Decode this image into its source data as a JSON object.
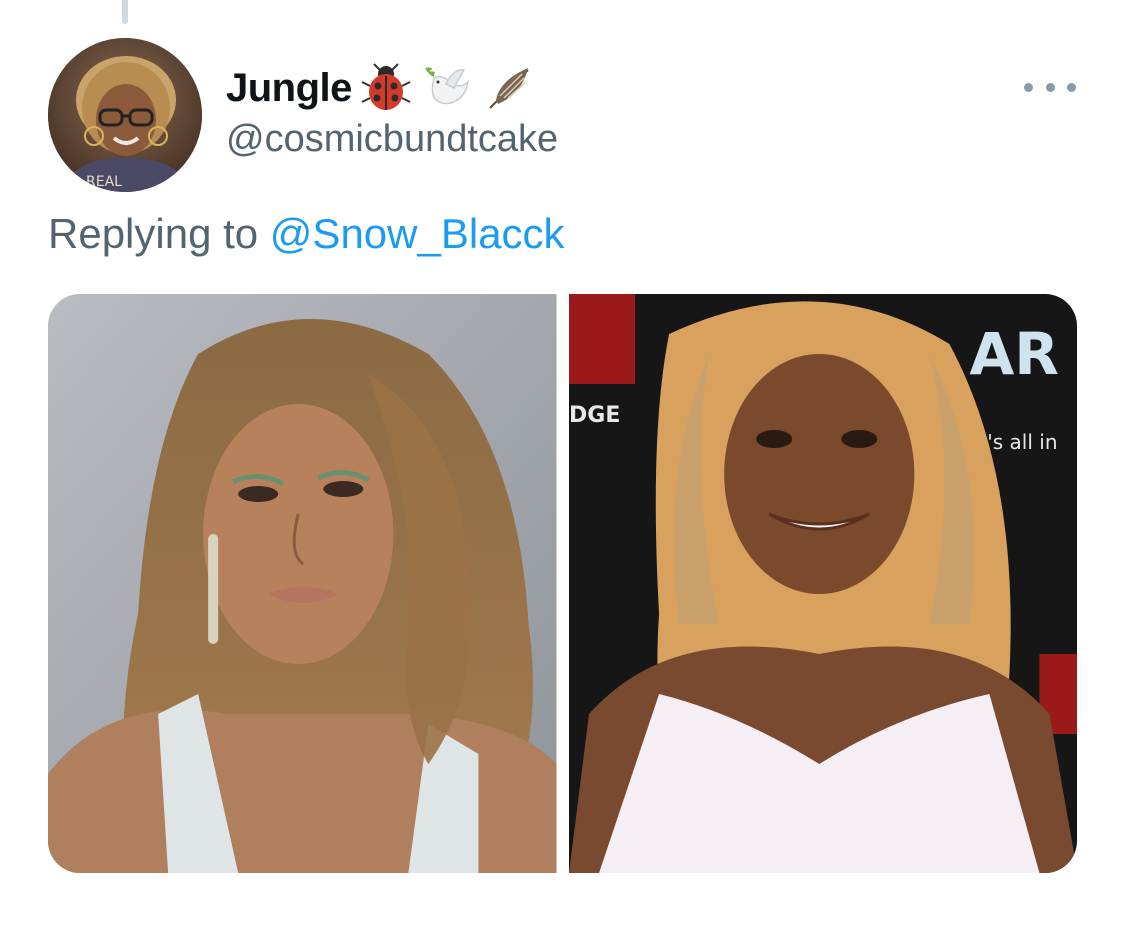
{
  "tweet": {
    "author": {
      "display_name": "Jungle",
      "emojis": [
        "ladybug-emoji",
        "dove-emoji",
        "feather-emoji"
      ],
      "handle": "@cosmicbundtcake",
      "avatar_shirt_text": "REAL"
    },
    "reply": {
      "prefix": "Replying to",
      "mention": "@Snow_Blacck"
    },
    "media": {
      "left_photo": {
        "description_icon": "portrait-photo"
      },
      "right_photo": {
        "backdrop_texts": [
          "DGE",
          "AR",
          "t's all in"
        ]
      }
    },
    "more_icon": "more-horizontal-icon"
  },
  "colors": {
    "primary_text": "#0f1419",
    "secondary_text": "#536471",
    "link": "#1d9bf0",
    "thread_line": "#cfd9de"
  }
}
